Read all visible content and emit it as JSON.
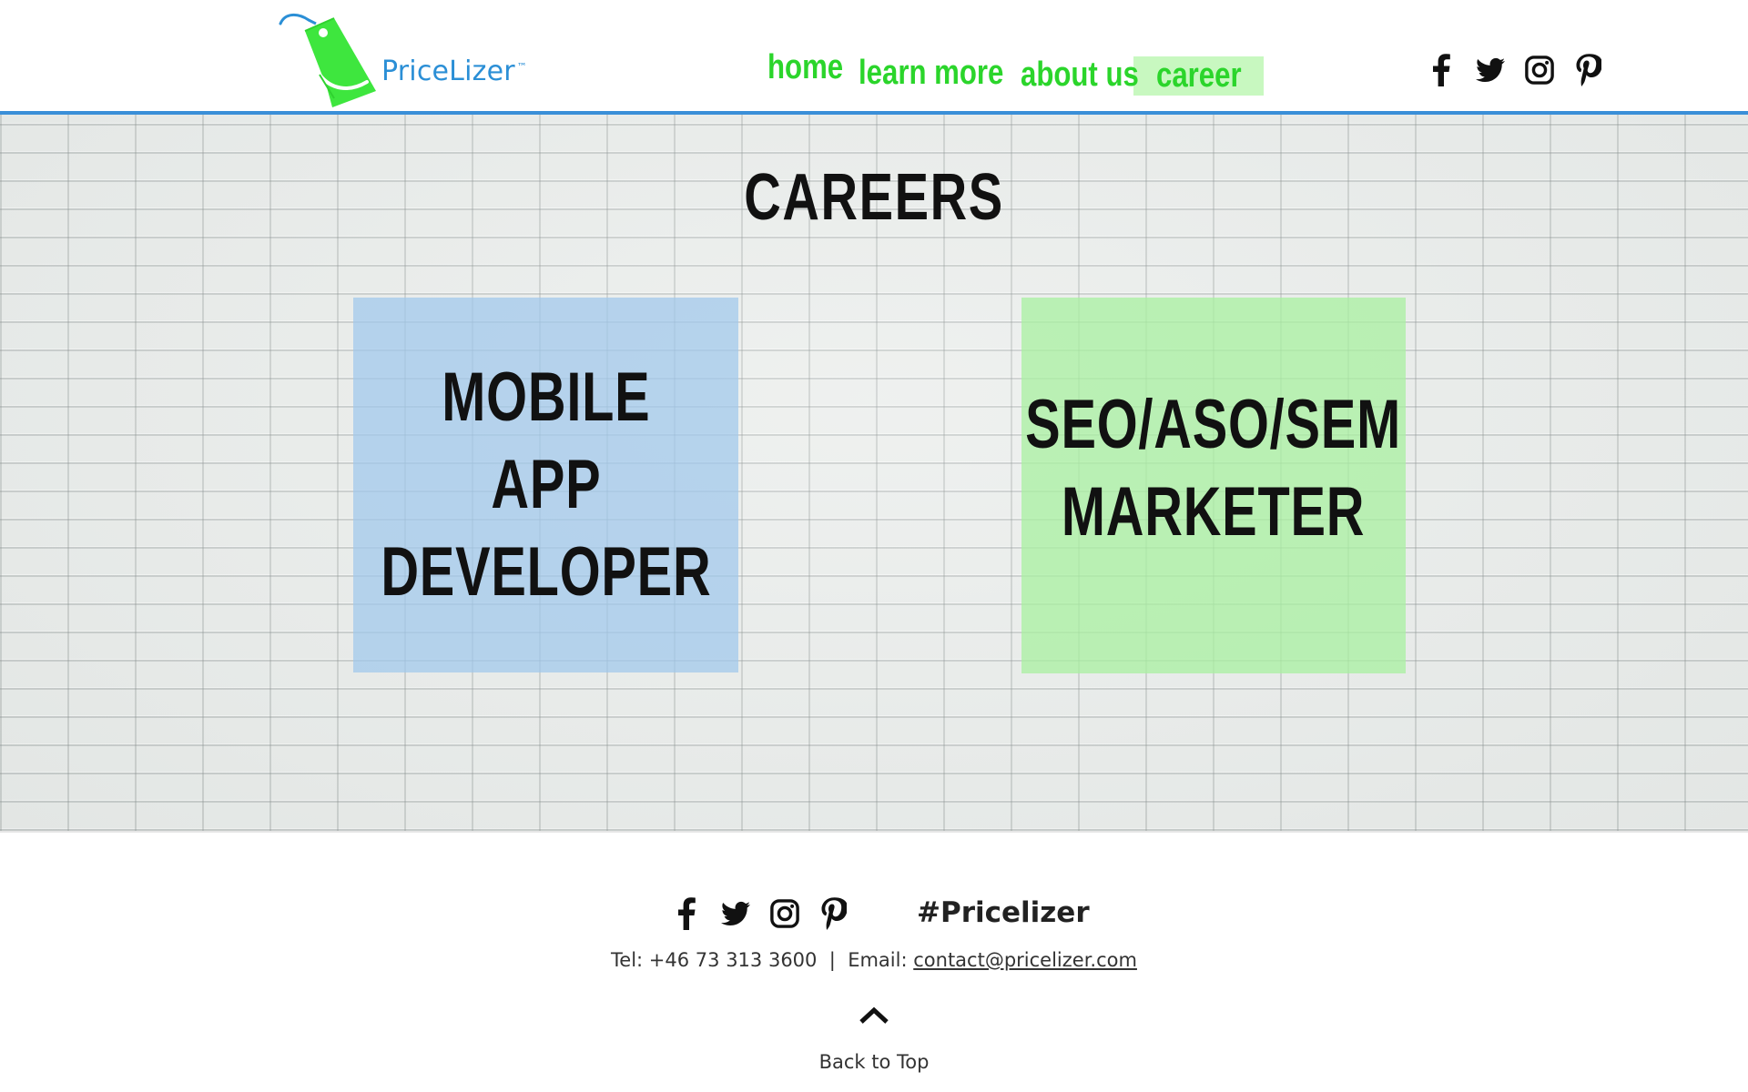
{
  "brand": {
    "name": "PriceLizer",
    "trademark": "™",
    "colors": {
      "tag_green": "#3ee63e",
      "text_blue": "#2b8fd6"
    }
  },
  "nav": {
    "items": [
      {
        "label": "home"
      },
      {
        "label": "learn more"
      },
      {
        "label": "about us"
      },
      {
        "label": "career",
        "active": true
      }
    ],
    "color": "#2bd52b",
    "active_bg": "#c8f8c0"
  },
  "social": {
    "icons": [
      "facebook-icon",
      "twitter-icon",
      "instagram-icon",
      "pinterest-icon"
    ]
  },
  "main": {
    "title": "CAREERS",
    "positions": [
      {
        "lines": [
          "MOBILE",
          "APP",
          "DEVELOPER"
        ],
        "color": "#a0c8ec"
      },
      {
        "lines": [
          "SEO/ASO/SEM",
          "MARKETER"
        ],
        "color": "#a8f0a0"
      }
    ]
  },
  "footer": {
    "hashtag": "#Pricelizer",
    "tel_label": "Tel: +46 73 313 3600",
    "separator": "|",
    "email_label": "Email:",
    "email": "contact@pricelizer.com",
    "back_to_top": "Back to Top"
  }
}
